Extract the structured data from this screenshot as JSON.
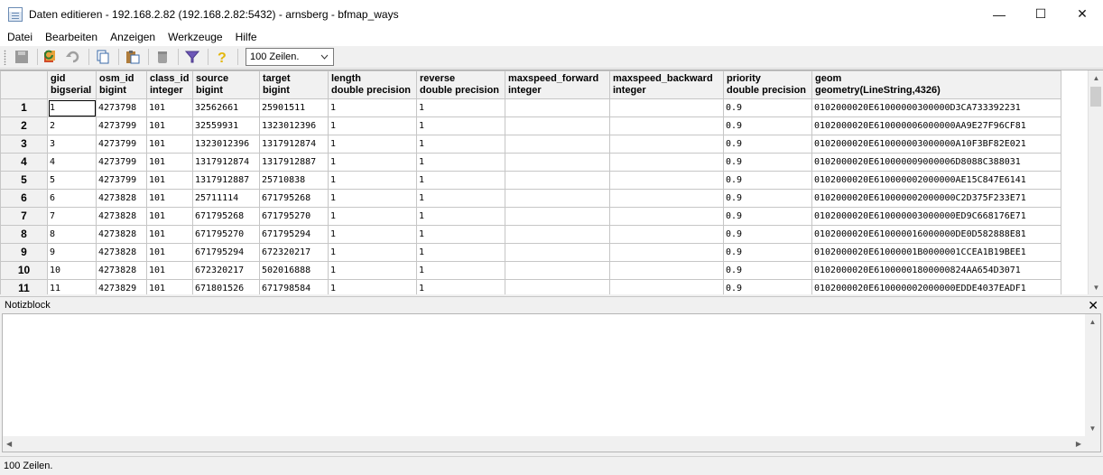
{
  "window": {
    "title": "Daten editieren - 192.168.2.82 (192.168.2.82:5432) - arnsberg - bfmap_ways",
    "minimize": "—",
    "maximize": "☐",
    "close": "✕"
  },
  "menu": [
    "Datei",
    "Bearbeiten",
    "Anzeigen",
    "Werkzeuge",
    "Hilfe"
  ],
  "toolbar": {
    "icons": [
      "save-icon",
      "refresh-icon",
      "undo-icon",
      "copy-icon",
      "paste-icon",
      "delete-icon",
      "filter-icon",
      "help-icon"
    ],
    "rows_select": "100 Zeilen."
  },
  "grid": {
    "columns": [
      {
        "name": "gid",
        "type": "bigserial"
      },
      {
        "name": "osm_id",
        "type": "bigint"
      },
      {
        "name": "class_id",
        "type": "integer"
      },
      {
        "name": "source",
        "type": "bigint"
      },
      {
        "name": "target",
        "type": "bigint"
      },
      {
        "name": "length",
        "type": "double precision"
      },
      {
        "name": "reverse",
        "type": "double precision"
      },
      {
        "name": "maxspeed_forward",
        "type": "integer"
      },
      {
        "name": "maxspeed_backward",
        "type": "integer"
      },
      {
        "name": "priority",
        "type": "double precision"
      },
      {
        "name": "geom",
        "type": "geometry(LineString,4326)"
      }
    ],
    "rows": [
      [
        "1",
        "1",
        "4273798",
        "101",
        "32562661",
        "25901511",
        "1",
        "1",
        "",
        "",
        "0.9",
        "0102000020E61000000300000D3CA733392231"
      ],
      [
        "2",
        "2",
        "4273799",
        "101",
        "32559931",
        "1323012396",
        "1",
        "1",
        "",
        "",
        "0.9",
        "0102000020E610000006000000AA9E27F96CF81"
      ],
      [
        "3",
        "3",
        "4273799",
        "101",
        "1323012396",
        "1317912874",
        "1",
        "1",
        "",
        "",
        "0.9",
        "0102000020E610000003000000A10F3BF82E021"
      ],
      [
        "4",
        "4",
        "4273799",
        "101",
        "1317912874",
        "1317912887",
        "1",
        "1",
        "",
        "",
        "0.9",
        "0102000020E610000009000006D8088C388031"
      ],
      [
        "5",
        "5",
        "4273799",
        "101",
        "1317912887",
        "25710838",
        "1",
        "1",
        "",
        "",
        "0.9",
        "0102000020E610000002000000AE15C847E6141"
      ],
      [
        "6",
        "6",
        "4273828",
        "101",
        "25711114",
        "671795268",
        "1",
        "1",
        "",
        "",
        "0.9",
        "0102000020E610000002000000C2D375F233E71"
      ],
      [
        "7",
        "7",
        "4273828",
        "101",
        "671795268",
        "671795270",
        "1",
        "1",
        "",
        "",
        "0.9",
        "0102000020E610000003000000ED9C668176E71"
      ],
      [
        "8",
        "8",
        "4273828",
        "101",
        "671795270",
        "671795294",
        "1",
        "1",
        "",
        "",
        "0.9",
        "0102000020E610000016000000DE0D582888E81"
      ],
      [
        "9",
        "9",
        "4273828",
        "101",
        "671795294",
        "672320217",
        "1",
        "1",
        "",
        "",
        "0.9",
        "0102000020E61000001B0000001CCEA1B19BEE1"
      ],
      [
        "10",
        "10",
        "4273828",
        "101",
        "672320217",
        "502016888",
        "1",
        "1",
        "",
        "",
        "0.9",
        "0102000020E61000001800000824AA654D3071"
      ],
      [
        "11",
        "11",
        "4273829",
        "101",
        "671801526",
        "671798584",
        "1",
        "1",
        "",
        "",
        "0.9",
        "0102000020E610000002000000EDDE4037EADF1"
      ]
    ]
  },
  "notepad": {
    "label": "Notizblock",
    "close": "✕",
    "content": ""
  },
  "status": {
    "text": "100 Zeilen."
  }
}
